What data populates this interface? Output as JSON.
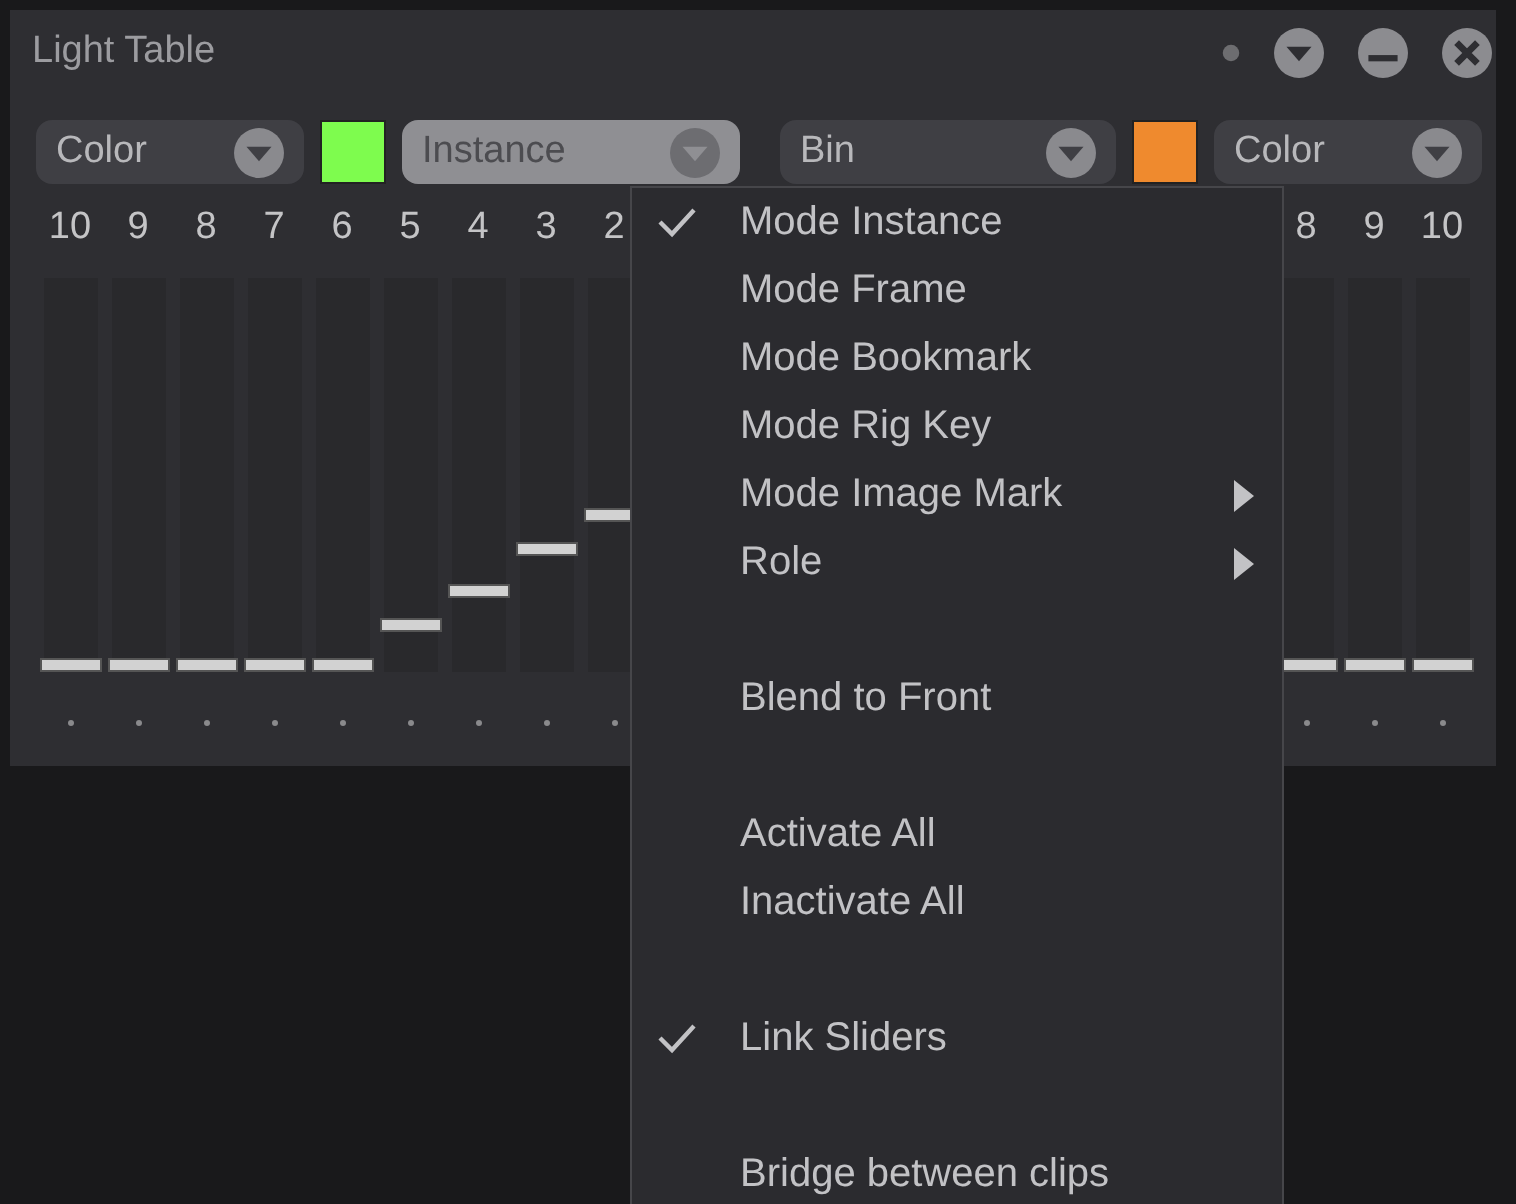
{
  "window": {
    "title": "Light Table"
  },
  "title_buttons": [
    {
      "kind": "dot"
    },
    {
      "kind": "dropdown"
    },
    {
      "kind": "minimize"
    },
    {
      "kind": "close"
    }
  ],
  "toolbar": [
    {
      "kind": "dropdown",
      "label": "Color",
      "open": false
    },
    {
      "kind": "swatch",
      "color": "#7efc4e"
    },
    {
      "kind": "dropdown",
      "label": "Instance",
      "open": true
    },
    {
      "kind": "dropdown",
      "label": "Bin",
      "open": false
    },
    {
      "kind": "swatch",
      "color": "#ef8a2e"
    },
    {
      "kind": "dropdown",
      "label": "Color",
      "open": false
    }
  ],
  "left_faders": [
    {
      "label": "10",
      "level": 0
    },
    {
      "label": "9",
      "level": 0
    },
    {
      "label": "8",
      "level": 0
    },
    {
      "label": "7",
      "level": 0
    },
    {
      "label": "6",
      "level": 0
    },
    {
      "label": "5",
      "level": 0.105
    },
    {
      "label": "4",
      "level": 0.195
    },
    {
      "label": "3",
      "level": 0.305
    },
    {
      "label": "2",
      "level": 0.395
    }
  ],
  "right_faders": [
    {
      "label": "8",
      "level": 0
    },
    {
      "label": "9",
      "level": 0
    },
    {
      "label": "10",
      "level": 0
    }
  ],
  "menu": {
    "items": [
      {
        "kind": "item",
        "label": "Mode Instance",
        "checked": true,
        "submenu": false
      },
      {
        "kind": "item",
        "label": "Mode Frame",
        "checked": false,
        "submenu": false
      },
      {
        "kind": "item",
        "label": "Mode Bookmark",
        "checked": false,
        "submenu": false
      },
      {
        "kind": "item",
        "label": "Mode Rig Key",
        "checked": false,
        "submenu": false
      },
      {
        "kind": "item",
        "label": "Mode Image Mark",
        "checked": false,
        "submenu": true
      },
      {
        "kind": "item",
        "label": "Role",
        "checked": false,
        "submenu": true
      },
      {
        "kind": "separator"
      },
      {
        "kind": "item",
        "label": "Blend to Front",
        "checked": false,
        "submenu": false
      },
      {
        "kind": "separator"
      },
      {
        "kind": "item",
        "label": "Activate All",
        "checked": false,
        "submenu": false
      },
      {
        "kind": "item",
        "label": "Inactivate All",
        "checked": false,
        "submenu": false
      },
      {
        "kind": "separator"
      },
      {
        "kind": "item",
        "label": "Link Sliders",
        "checked": true,
        "submenu": false
      },
      {
        "kind": "separator"
      },
      {
        "kind": "item",
        "label": "Bridge between clips",
        "checked": false,
        "submenu": false
      }
    ]
  }
}
